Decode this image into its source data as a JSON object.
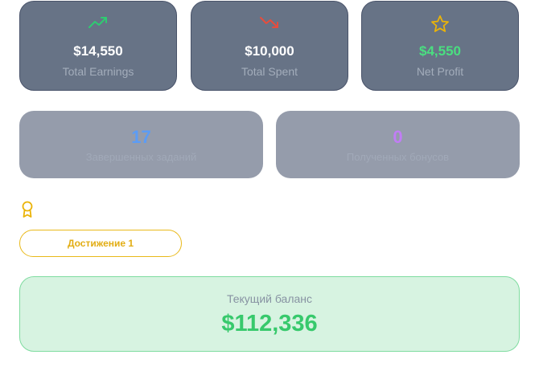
{
  "stats": [
    {
      "icon": "trending-up-icon",
      "value": "$14,550",
      "label": "Total Earnings",
      "value_color": "#ffffff",
      "icon_color": "#2ecc71"
    },
    {
      "icon": "trending-down-icon",
      "value": "$10,000",
      "label": "Total Spent",
      "value_color": "#ffffff",
      "icon_color": "#e74c3c"
    },
    {
      "icon": "star-icon",
      "value": "$4,550",
      "label": "Net Profit",
      "value_color": "#4ade80",
      "icon_color": "#eab308"
    }
  ],
  "mid_stats": [
    {
      "value": "17",
      "label": "Завершенных заданий",
      "value_color": "#5b9cf6"
    },
    {
      "value": "0",
      "label": "Полученных бонусов",
      "value_color": "#c17df5"
    }
  ],
  "achievements": {
    "icon": "award-icon",
    "icon_color": "#eab308",
    "items": [
      "Достижение 1"
    ]
  },
  "balance": {
    "label": "Текущий баланс",
    "value": "$112,336",
    "color": "#37c96c"
  }
}
